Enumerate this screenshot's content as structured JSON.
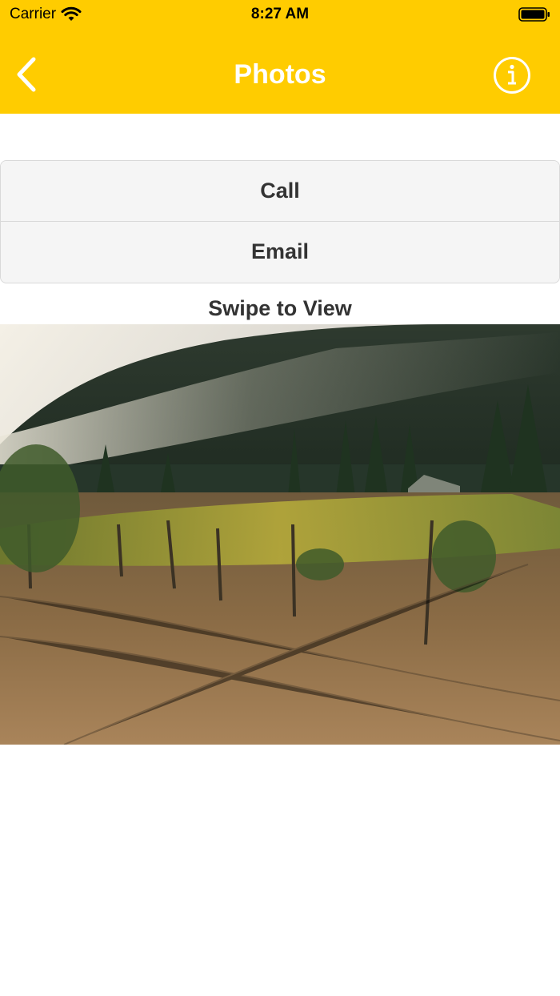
{
  "status_bar": {
    "carrier": "Carrier",
    "time": "8:27 AM",
    "icons": [
      "wifi-icon",
      "battery-icon"
    ]
  },
  "nav": {
    "title": "Photos",
    "back_icon": "chevron-left-icon",
    "info_icon": "info-circle-icon"
  },
  "actions": {
    "call_label": "Call",
    "email_label": "Email"
  },
  "gallery": {
    "label": "Swipe to View",
    "photo_alt": "vineyard photo"
  },
  "colors": {
    "accent": "#FFCC00",
    "title_text": "#FFFFFF",
    "button_bg": "#F5F5F5",
    "button_text": "#333333"
  }
}
